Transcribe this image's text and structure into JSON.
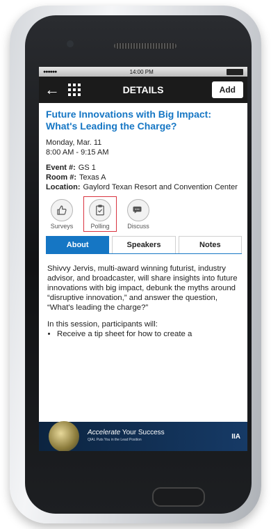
{
  "status": {
    "time": "14:00 PM",
    "signal": "●●●●●●"
  },
  "nav": {
    "title": "DETAILS",
    "add_label": "Add"
  },
  "session": {
    "title": "Future Innovations with Big Impact: What's Leading the Charge?",
    "date": "Monday, Mar. 11",
    "time": "8:00 AM - 9:15 AM",
    "event_label": "Event #:",
    "event_value": "GS 1",
    "room_label": "Room #:",
    "room_value": "Texas A",
    "location_label": "Location:",
    "location_value": "Gaylord Texan Resort and Convention Center"
  },
  "actions": [
    {
      "label": "Surveys",
      "icon": "thumbs-up-icon"
    },
    {
      "label": "Polling",
      "icon": "clipboard-check-icon"
    },
    {
      "label": "Discuss",
      "icon": "chat-bubble-icon"
    }
  ],
  "tabs": [
    {
      "label": "About"
    },
    {
      "label": "Speakers"
    },
    {
      "label": "Notes"
    }
  ],
  "about": {
    "paragraph": "Shivvy Jervis, multi-award winning futurist, industry advisor, and broadcaster, will share insights into future innovations with big impact, debunk the myths around “disruptive innovation,” and answer the question, “What's leading the charge?”",
    "intro": "In this session, participants will:",
    "bullets": [
      "Receive a tip sheet for how to create a"
    ]
  },
  "banner": {
    "accent": "Accelerate",
    "rest": " Your Success",
    "tagline": "QIAL Puts You in the Lead Position",
    "logo": "IIA"
  },
  "colors": {
    "accent": "#1576c4",
    "highlight": "#d9333f",
    "navbar": "#1b1b1b"
  }
}
